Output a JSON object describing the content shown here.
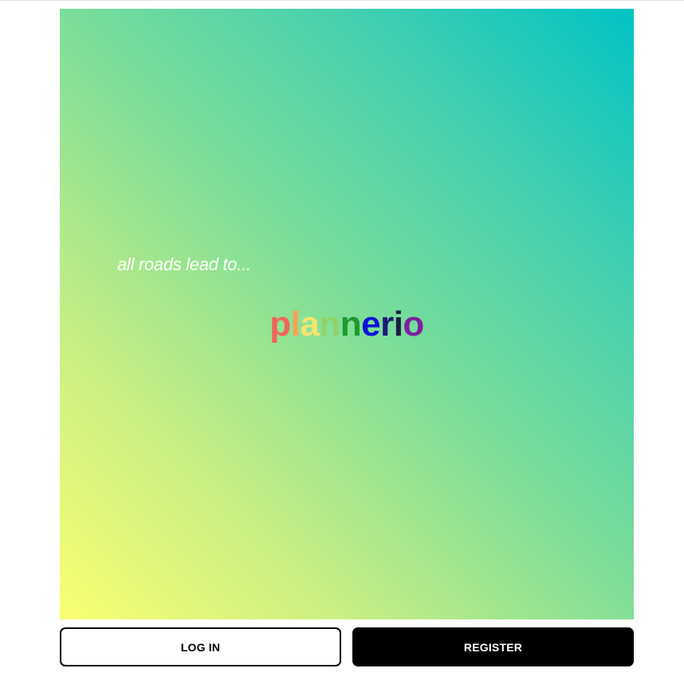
{
  "hero": {
    "tagline": "all roads lead to...",
    "logo_letters": [
      {
        "char": "p",
        "color": "#f2645a"
      },
      {
        "char": "l",
        "color": "#f6a25a"
      },
      {
        "char": "a",
        "color": "#f6e46e"
      },
      {
        "char": "n",
        "color": "#8fd46a"
      },
      {
        "char": "n",
        "color": "#1e9a2e"
      },
      {
        "char": "e",
        "color": "#0b14d6"
      },
      {
        "char": "r",
        "color": "#1a1a78"
      },
      {
        "char": "i",
        "color": "#1c1c40"
      },
      {
        "char": "o",
        "color": "#7e1da0"
      }
    ],
    "gradient_colors": [
      "#faff72",
      "#7fde98",
      "#00c3c4"
    ]
  },
  "actions": {
    "login_label": "LOG IN",
    "register_label": "REGISTER"
  }
}
